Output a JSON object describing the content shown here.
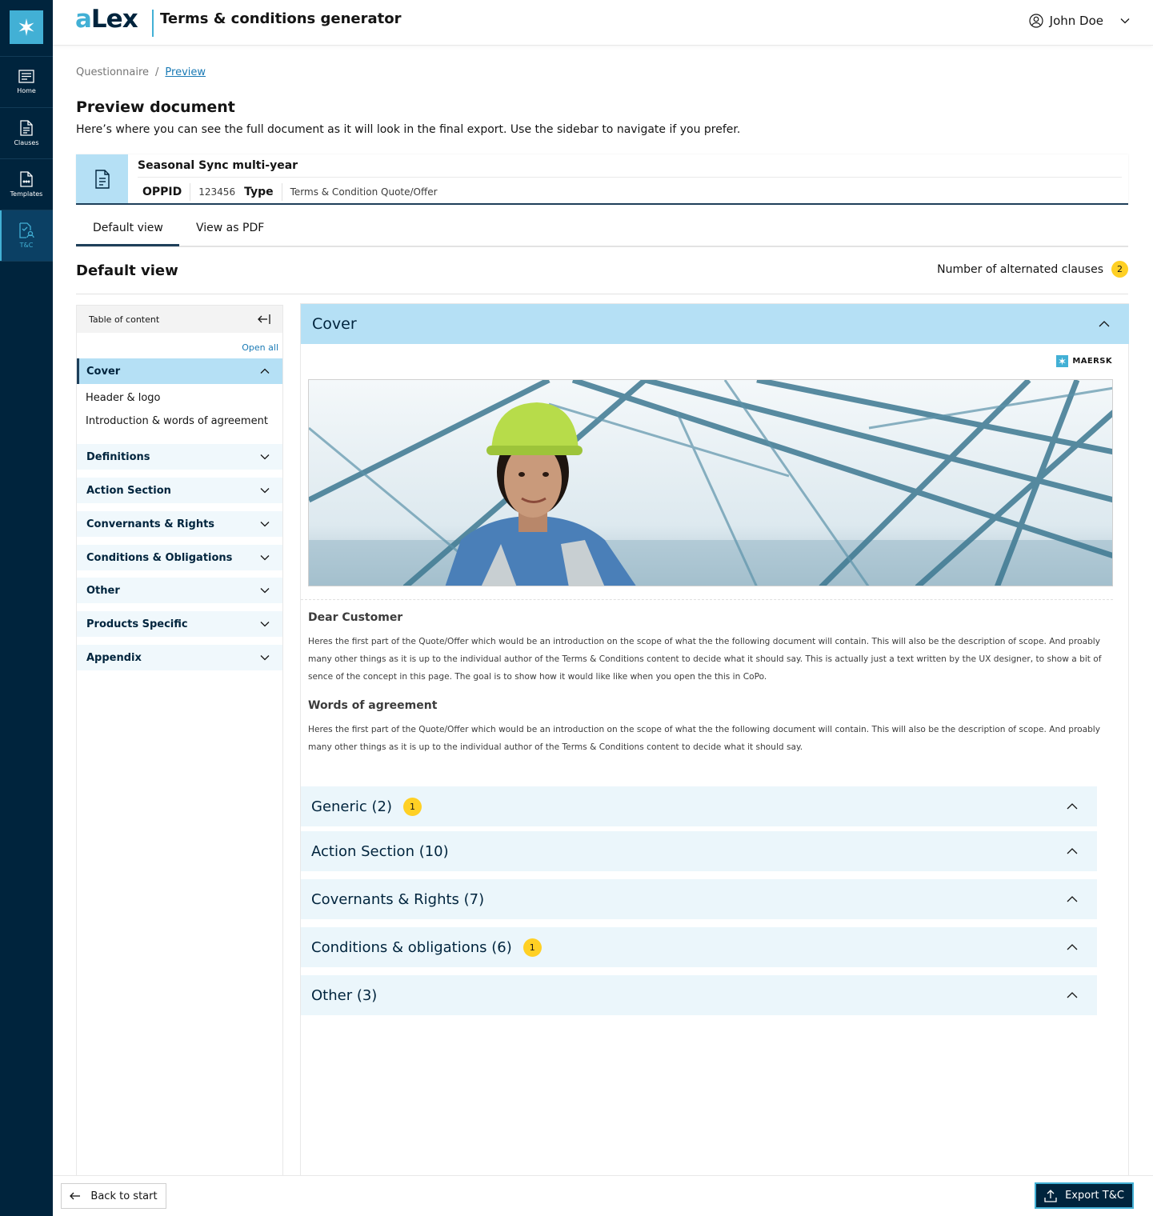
{
  "nav": {
    "items": [
      {
        "label": "Home",
        "icon": "home-icon"
      },
      {
        "label": "Clauses",
        "icon": "clauses-icon"
      },
      {
        "label": "Templates",
        "icon": "templates-icon"
      },
      {
        "label": "T&C",
        "icon": "tc-icon",
        "active": true
      }
    ]
  },
  "header": {
    "brand_accent": "a",
    "brand_rest": "Lex",
    "app_title": "Terms & conditions generator",
    "user_name": "John Doe"
  },
  "breadcrumb": {
    "first": "Questionnaire",
    "separator": "/",
    "current": "Preview"
  },
  "page": {
    "title": "Preview document",
    "subtitle": "Here’s where you can see the full document as it will look in the final export.  Use the sidebar to navigate if you prefer."
  },
  "document": {
    "name": "Seasonal Sync multi-year",
    "oppid_label": "OPPID",
    "oppid_value": "123456",
    "type_label": "Type",
    "type_value": "Terms & Condition Quote/Offer"
  },
  "tabs": {
    "default": "Default view",
    "pdf": "View as PDF"
  },
  "default_view": {
    "title": "Default view",
    "alt_clauses_label": "Number of alternated clauses",
    "alt_clauses_count": "2"
  },
  "toc": {
    "title": "Table of content",
    "open_all": "Open all",
    "cover": "Cover",
    "cover_children": [
      "Header & logo",
      "Introduction & words of agreement"
    ],
    "sections": [
      "Definitions",
      "Action Section",
      "Convernants & Rights",
      "Conditions & Obligations",
      "Other",
      "Products Specific",
      "Appendix"
    ]
  },
  "preview": {
    "cover_title": "Cover",
    "brand_name": "MAERSK",
    "dear_heading": "Dear Customer",
    "dear_text": "Heres the first part of the Quote/Offer which would be an introduction on the scope of what the the following document will contain. This will also be the description of scope. And proably many other things as it is up to the individual author of the Terms & Conditions content to decide what it should say. This is actually just a text written by the UX designer, to show a bit of sence of the concept in this page. The goal is to show how it would like like when you open the this in CoPo.",
    "words_heading": "Words of agreement",
    "words_text": "Heres the first part of the Quote/Offer which would be an introduction on the scope of what the the following document will contain. This will also be the description of scope. And proably many other things as it is up to the individual author of the Terms & Conditions content to decide what it should say.",
    "sections": [
      {
        "label": "Generic (2)",
        "badge": "1"
      },
      {
        "label": "Action Section (10)",
        "badge": ""
      },
      {
        "label": "Covernants & Rights (7)",
        "badge": ""
      },
      {
        "label": "Conditions & obligations (6)",
        "badge": "1"
      },
      {
        "label": "Other (3)",
        "badge": ""
      }
    ]
  },
  "footer": {
    "back_label": "Back to start",
    "export_label": "Export T&C"
  },
  "colors": {
    "navy": "#00243d",
    "accent": "#42b0d5",
    "light_blue": "#b5e0f5",
    "pale_blue": "#ebf6fb",
    "badge": "#ffd024"
  }
}
